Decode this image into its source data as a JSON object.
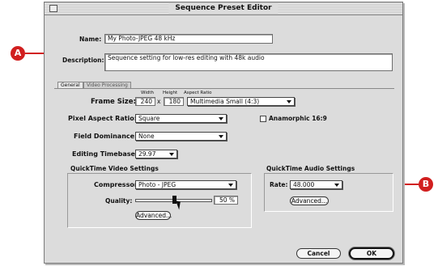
{
  "window": {
    "title": "Sequence Preset Editor"
  },
  "callouts": {
    "a": "A",
    "b": "B"
  },
  "name_label": "Name:",
  "name_value": "My Photo-JPEG 48 kHz",
  "description_label": "Description:",
  "description_value": "Sequence setting for low-res editing with 48k audio",
  "tabs": [
    {
      "label": "General",
      "active": true
    },
    {
      "label": "Video Processing",
      "active": false
    }
  ],
  "frame_size": {
    "label": "Frame Size:",
    "width_header": "Width",
    "height_header": "Height",
    "aspect_header": "Aspect Ratio",
    "width": "240",
    "x_sep": "x",
    "height": "180",
    "aspect": "Multimedia Small (4:3)"
  },
  "pixel_aspect": {
    "label": "Pixel Aspect Ratio:",
    "value": "Square"
  },
  "anamorphic": {
    "label": "Anamorphic 16:9",
    "checked": false
  },
  "field_dominance": {
    "label": "Field Dominance:",
    "value": "None"
  },
  "editing_timebase": {
    "label": "Editing Timebase:",
    "value": "29.97"
  },
  "video_settings": {
    "heading": "QuickTime Video Settings",
    "compressor_label": "Compressor:",
    "compressor_value": "Photo - JPEG",
    "quality_label": "Quality:",
    "quality_percent": 50,
    "quality_text": "50 %",
    "advanced_label": "Advanced..."
  },
  "audio_settings": {
    "heading": "QuickTime Audio Settings",
    "rate_label": "Rate:",
    "rate_value": "48.000",
    "advanced_label": "Advanced..."
  },
  "buttons": {
    "cancel": "Cancel",
    "ok": "OK"
  },
  "colors": {
    "callout": "#d11f1f",
    "bracket": "#e07a1f",
    "window_bg": "#dcdcdc"
  }
}
